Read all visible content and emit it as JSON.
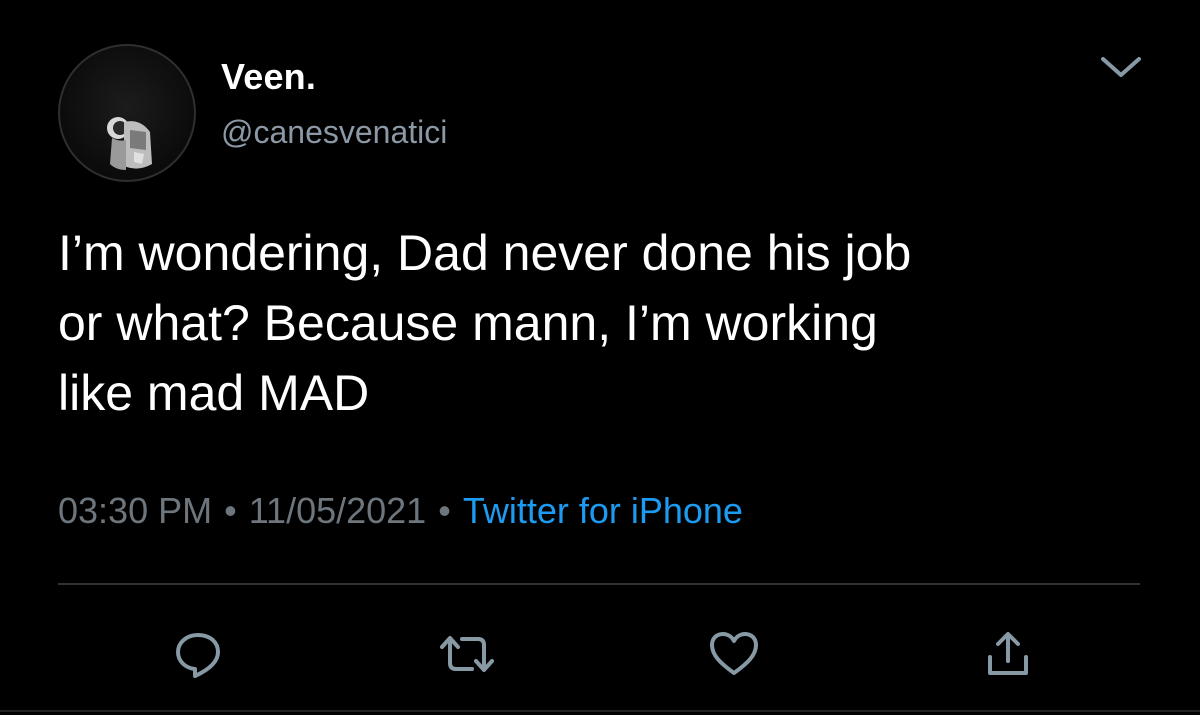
{
  "author": {
    "display_name": "Veen.",
    "handle": "@canesvenatici"
  },
  "tweet": {
    "text": "I’m wondering, Dad never done his job\nor what? Because mann, I’m working\nlike mad MAD",
    "time": "03:30 PM",
    "date": "11/05/2021",
    "separator": "•",
    "source": "Twitter for iPhone"
  },
  "actions": {
    "reply_icon": "reply-icon",
    "retweet_icon": "retweet-icon",
    "like_icon": "like-icon",
    "share_icon": "share-icon"
  },
  "colors": {
    "background": "#000000",
    "text_primary": "#ffffff",
    "text_secondary": "#8b98a5",
    "link": "#1d9bf0",
    "icon": "#8899a6",
    "divider": "#2f3336"
  }
}
